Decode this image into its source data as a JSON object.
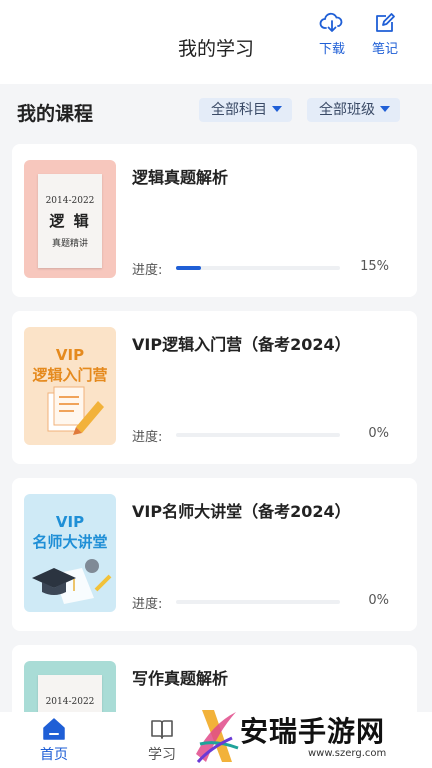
{
  "header": {
    "title": "我的学习",
    "download_label": "下载",
    "notes_label": "笔记"
  },
  "section": {
    "title": "我的课程",
    "filter_subject": "全部科目",
    "filter_class": "全部班级"
  },
  "courses": [
    {
      "title": "逻辑真题解析",
      "progress_label": "进度:",
      "progress_text": "15%",
      "progress": 0.15,
      "cover": {
        "year": "2014-2022",
        "big": "逻 辑",
        "sub": "真题精讲"
      }
    },
    {
      "title": "VIP逻辑入门营（备考2024）",
      "progress_label": "进度:",
      "progress_text": "0%",
      "progress": 0,
      "cover": {
        "line1": "VIP",
        "line2": "逻辑入门营"
      }
    },
    {
      "title": "VIP名师大讲堂（备考2024）",
      "progress_label": "进度:",
      "progress_text": "0%",
      "progress": 0,
      "cover": {
        "line1": "VIP",
        "line2": "名师大讲堂"
      }
    },
    {
      "title": "写作真题解析",
      "cover": {
        "year": "2014-2022"
      }
    }
  ],
  "tabbar": {
    "home_label": "首页",
    "study_label": "学习"
  },
  "watermark": {
    "text": "安瑞手游网",
    "url": "www.szerg.com"
  },
  "colors": {
    "accent": "#1f5fd6",
    "background": "#f4f5f7"
  }
}
